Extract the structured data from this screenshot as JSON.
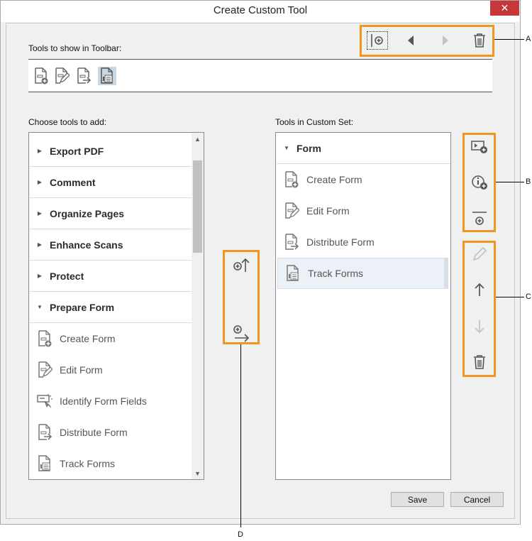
{
  "window": {
    "title": "Create Custom Tool",
    "close_glyph": "✕"
  },
  "toolbar_section": {
    "label": "Tools to show in Toolbar:",
    "icons": [
      "create-form-icon",
      "edit-form-icon",
      "distribute-form-icon",
      "track-forms-icon"
    ],
    "selected_index": 3
  },
  "top_actions": [
    "add-separator-icon",
    "move-left-icon",
    "move-right-icon",
    "delete-icon"
  ],
  "left_panel": {
    "label": "Choose tools to add:",
    "categories": [
      {
        "label": "Export PDF",
        "expanded": false
      },
      {
        "label": "Comment",
        "expanded": false
      },
      {
        "label": "Organize Pages",
        "expanded": false
      },
      {
        "label": "Enhance Scans",
        "expanded": false
      },
      {
        "label": "Protect",
        "expanded": false
      },
      {
        "label": "Prepare Form",
        "expanded": true
      }
    ],
    "tools": [
      "Create Form",
      "Edit Form",
      "Identify Form Fields",
      "Distribute Form",
      "Track Forms"
    ],
    "collapsed_glyph": "▶",
    "expanded_glyph": "▼",
    "scroll_up": "▲",
    "scroll_down": "▼"
  },
  "middle_actions": [
    "add-to-toolbar-icon",
    "add-to-custom-set-icon"
  ],
  "right_panel": {
    "label": "Tools in Custom Set:",
    "category": "Form",
    "tools": [
      "Create Form",
      "Edit Form",
      "Distribute Form",
      "Track Forms"
    ],
    "selected_index": 3
  },
  "side_actions_b": [
    "add-tool-icon",
    "add-info-icon",
    "add-separator-icon"
  ],
  "side_actions_c": [
    "rename-icon",
    "move-up-icon",
    "move-down-icon",
    "delete-icon"
  ],
  "buttons": {
    "save": "Save",
    "cancel": "Cancel"
  },
  "callouts": {
    "a": "A",
    "b": "B",
    "c": "C",
    "d": "D"
  },
  "colors": {
    "highlight": "#f3961f",
    "close": "#c7373a",
    "selection": "#c9d6e3"
  }
}
